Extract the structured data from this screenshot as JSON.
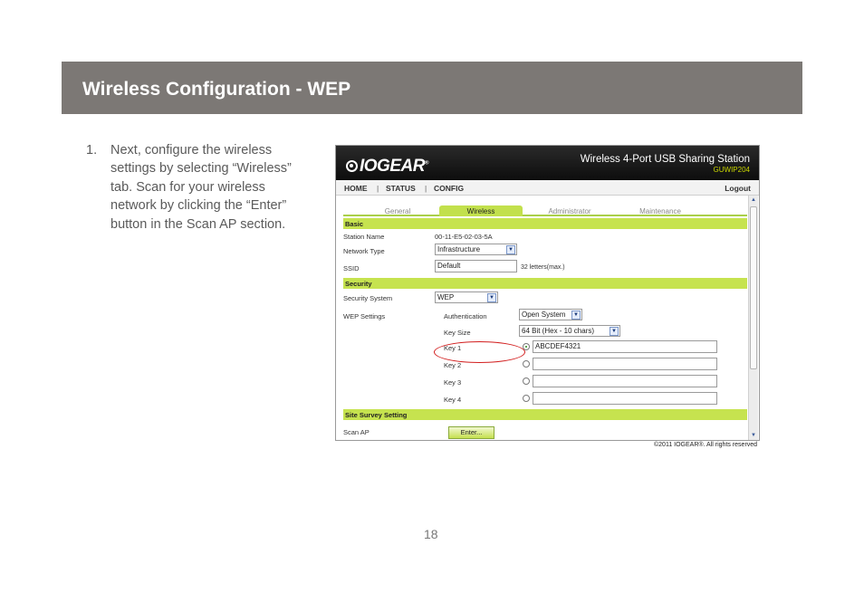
{
  "header": {
    "title": "Wireless Configuration - WEP"
  },
  "instructions": {
    "number": "1.",
    "lines": [
      "Next, configure the wireless",
      "settings by selecting “Wireless”",
      "tab. Scan for  your wireless",
      "network by clicking the “Enter”",
      "button in the Scan AP section."
    ]
  },
  "screenshot": {
    "brand": "IOGEAR",
    "brand_mark": "®",
    "product_name": "Wireless 4-Port USB Sharing Station",
    "model": "GUWIP204",
    "nav": {
      "home": "HOME",
      "status": "STATUS",
      "config": "CONFIG",
      "separator": "|",
      "logout": "Logout"
    },
    "tabs": [
      {
        "label": "General",
        "active": false
      },
      {
        "label": "Wireless",
        "active": true
      },
      {
        "label": "Administrator",
        "active": false
      },
      {
        "label": "Maintenance",
        "active": false
      }
    ],
    "basic": {
      "heading": "Basic",
      "station_name_label": "Station Name",
      "station_name_value": "00-11-E5-02-03-5A",
      "network_type_label": "Network Type",
      "network_type_value": "Infrastructure",
      "ssid_label": "SSID",
      "ssid_value": "Default",
      "ssid_hint": "32 letters(max.)"
    },
    "security": {
      "heading": "Security",
      "security_system_label": "Security System",
      "security_system_value": "WEP",
      "wep_settings_label": "WEP Settings",
      "authentication_label": "Authentication",
      "authentication_value": "Open System",
      "key_size_label": "Key Size",
      "key_size_value": "64 Bit (Hex - 10 chars)",
      "keys": [
        {
          "label": "Key 1",
          "value": "ABCDEF4321",
          "selected": true
        },
        {
          "label": "Key 2",
          "value": "",
          "selected": false
        },
        {
          "label": "Key 3",
          "value": "",
          "selected": false
        },
        {
          "label": "Key 4",
          "value": "",
          "selected": false
        }
      ]
    },
    "site_survey": {
      "heading": "Site Survey Setting",
      "scan_ap_label": "Scan AP",
      "enter_button": "Enter..."
    },
    "copyright": "©2011 IOGEAR®. All rights reserved"
  },
  "page_number": "18",
  "colors": {
    "header_band": "#7c7875",
    "section_green": "#c6e34f",
    "model_text": "#c8d400",
    "highlight_oval": "#d21d1d"
  },
  "icons": {
    "dropdown": "chevron-down-icon",
    "scroll_up": "scroll-up-icon",
    "scroll_down": "scroll-down-icon"
  }
}
